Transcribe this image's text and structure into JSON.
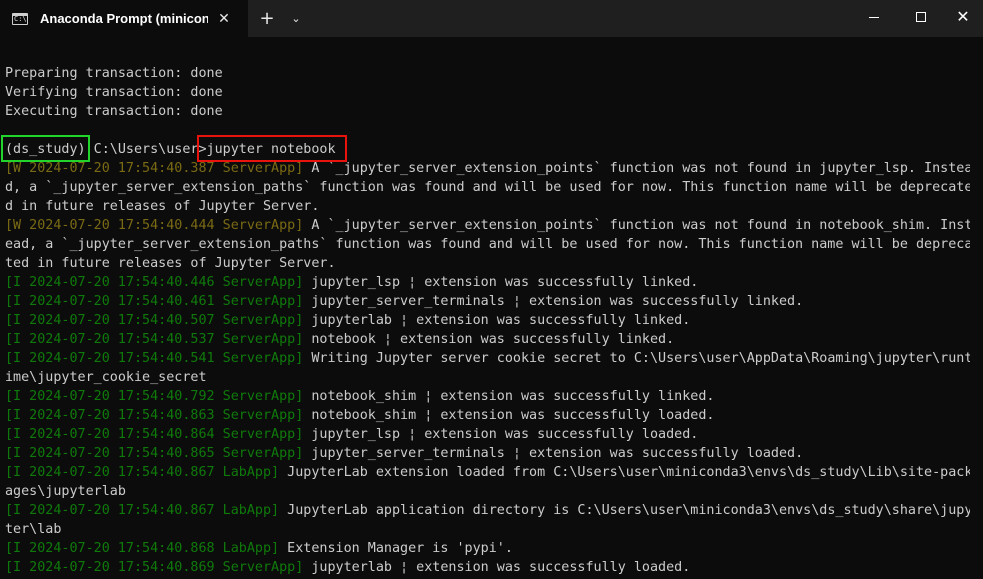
{
  "window": {
    "tab_title": "Anaconda Prompt (miniconda",
    "tab_icon": "terminal-icon",
    "tab_close_glyph": "✕",
    "new_tab_glyph": "+",
    "dropdown_glyph": "⌄",
    "minimize_icon": "minimize-icon",
    "maximize_icon": "maximize-icon",
    "close_glyph": "✕"
  },
  "colors": {
    "terminal_bg": "#0c0c0c",
    "text": "#cccccc",
    "warn_prefix": "#7a6a14",
    "info_prefix": "#0f7a0b",
    "highlight_env": "#22d32c",
    "highlight_command": "#e8130d"
  },
  "terminal": {
    "lines": [
      {
        "prefix": "",
        "text": "Preparing transaction: done"
      },
      {
        "prefix": "",
        "text": "Verifying transaction: done"
      },
      {
        "prefix": "",
        "text": "Executing transaction: done"
      },
      {
        "prefix": "",
        "text": ""
      },
      {
        "prefix": "",
        "text": "(ds_study) C:\\Users\\user>jupyter notebook"
      },
      {
        "prefix": "[W 2024-07-20 17:54:40.387 ServerApp]",
        "level": "warn",
        "text": " A `_jupyter_server_extension_points` function was not found in jupyter_lsp. Instea"
      },
      {
        "prefix": "",
        "text": "d, a `_jupyter_server_extension_paths` function was found and will be used for now. This function name will be deprecate"
      },
      {
        "prefix": "",
        "text": "d in future releases of Jupyter Server."
      },
      {
        "prefix": "[W 2024-07-20 17:54:40.444 ServerApp]",
        "level": "warn",
        "text": " A `_jupyter_server_extension_points` function was not found in notebook_shim. Inst"
      },
      {
        "prefix": "",
        "text": "ead, a `_jupyter_server_extension_paths` function was found and will be used for now. This function name will be depreca"
      },
      {
        "prefix": "",
        "text": "ted in future releases of Jupyter Server."
      },
      {
        "prefix": "[I 2024-07-20 17:54:40.446 ServerApp]",
        "level": "info",
        "text": " jupyter_lsp ¦ extension was successfully linked."
      },
      {
        "prefix": "[I 2024-07-20 17:54:40.461 ServerApp]",
        "level": "info",
        "text": " jupyter_server_terminals ¦ extension was successfully linked."
      },
      {
        "prefix": "[I 2024-07-20 17:54:40.507 ServerApp]",
        "level": "info",
        "text": " jupyterlab ¦ extension was successfully linked."
      },
      {
        "prefix": "[I 2024-07-20 17:54:40.537 ServerApp]",
        "level": "info",
        "text": " notebook ¦ extension was successfully linked."
      },
      {
        "prefix": "[I 2024-07-20 17:54:40.541 ServerApp]",
        "level": "info",
        "text": " Writing Jupyter server cookie secret to C:\\Users\\user\\AppData\\Roaming\\jupyter\\runt"
      },
      {
        "prefix": "",
        "text": "ime\\jupyter_cookie_secret"
      },
      {
        "prefix": "[I 2024-07-20 17:54:40.792 ServerApp]",
        "level": "info",
        "text": " notebook_shim ¦ extension was successfully linked."
      },
      {
        "prefix": "[I 2024-07-20 17:54:40.863 ServerApp]",
        "level": "info",
        "text": " notebook_shim ¦ extension was successfully loaded."
      },
      {
        "prefix": "[I 2024-07-20 17:54:40.864 ServerApp]",
        "level": "info",
        "text": " jupyter_lsp ¦ extension was successfully loaded."
      },
      {
        "prefix": "[I 2024-07-20 17:54:40.865 ServerApp]",
        "level": "info",
        "text": " jupyter_server_terminals ¦ extension was successfully loaded."
      },
      {
        "prefix": "[I 2024-07-20 17:54:40.867 LabApp]",
        "level": "info",
        "text": " JupyterLab extension loaded from C:\\Users\\user\\miniconda3\\envs\\ds_study\\Lib\\site-pack"
      },
      {
        "prefix": "",
        "text": "ages\\jupyterlab"
      },
      {
        "prefix": "[I 2024-07-20 17:54:40.867 LabApp]",
        "level": "info",
        "text": " JupyterLab application directory is C:\\Users\\user\\miniconda3\\envs\\ds_study\\share\\jupy"
      },
      {
        "prefix": "",
        "text": "ter\\lab"
      },
      {
        "prefix": "[I 2024-07-20 17:54:40.868 LabApp]",
        "level": "info",
        "text": " Extension Manager is 'pypi'."
      },
      {
        "prefix": "[I 2024-07-20 17:54:40.869 ServerApp]",
        "level": "info",
        "text": " jupyterlab ¦ extension was successfully loaded."
      }
    ]
  }
}
